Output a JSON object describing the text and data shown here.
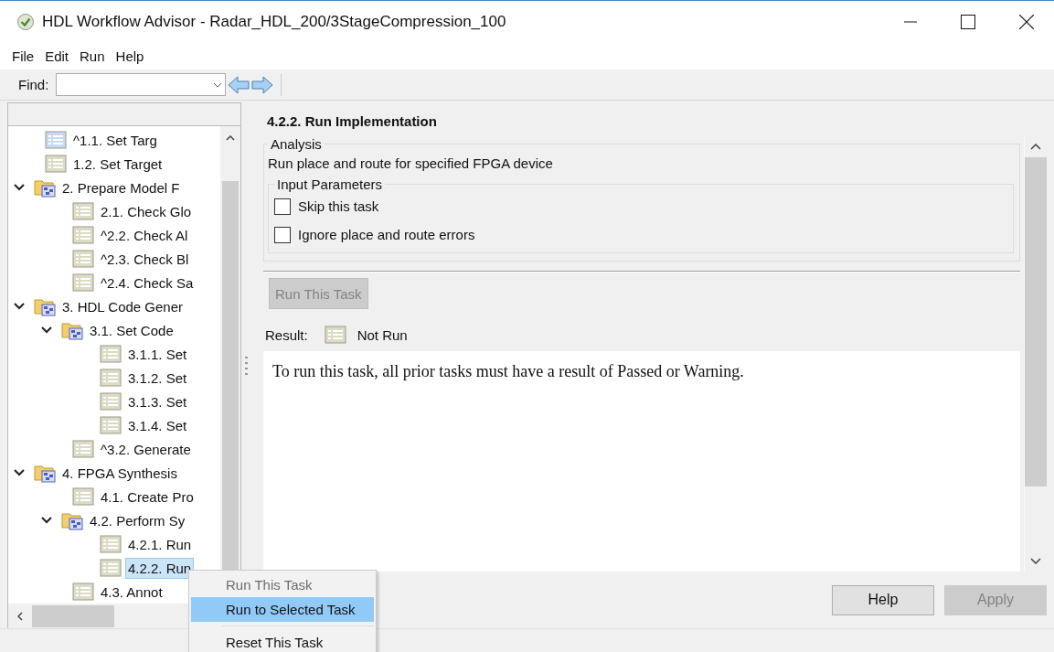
{
  "window": {
    "title": "HDL Workflow Advisor - Radar_HDL_200/3StageCompression_100"
  },
  "menu": [
    "File",
    "Edit",
    "Run",
    "Help"
  ],
  "toolbar": {
    "find_label": "Find:"
  },
  "tree": [
    {
      "kind": "task",
      "label": "^1.1. Set Targ",
      "color": "#c9d9f2",
      "selected": false
    },
    {
      "kind": "task",
      "label": "1.2. Set Target",
      "color": "#dcdcc6",
      "selected": false
    },
    {
      "kind": "folder",
      "label": "2. Prepare Model F",
      "expanded": true,
      "selected": false,
      "children": [
        {
          "kind": "task",
          "label": "2.1. Check Glo",
          "color": "#dcdcc6",
          "selected": false
        },
        {
          "kind": "task",
          "label": "^2.2. Check Al",
          "color": "#dcdcc6",
          "selected": false
        },
        {
          "kind": "task",
          "label": "^2.3. Check Bl",
          "color": "#dcdcc6",
          "selected": false
        },
        {
          "kind": "task",
          "label": "^2.4. Check Sa",
          "color": "#dcdcc6",
          "selected": false
        }
      ]
    },
    {
      "kind": "folder",
      "label": "3. HDL Code Gener",
      "expanded": true,
      "selected": false,
      "children": [
        {
          "kind": "folder",
          "label": "3.1. Set Code",
          "expanded": true,
          "selected": false,
          "children": [
            {
              "kind": "task",
              "label": "3.1.1. Set",
              "color": "#dcdcc6",
              "selected": false
            },
            {
              "kind": "task",
              "label": "3.1.2. Set",
              "color": "#dcdcc6",
              "selected": false
            },
            {
              "kind": "task",
              "label": "3.1.3. Set",
              "color": "#dcdcc6",
              "selected": false
            },
            {
              "kind": "task",
              "label": "3.1.4. Set",
              "color": "#dcdcc6",
              "selected": false
            }
          ]
        },
        {
          "kind": "task",
          "label": "^3.2. Generate",
          "color": "#dcdcc6",
          "selected": false
        }
      ]
    },
    {
      "kind": "folder",
      "label": "4. FPGA Synthesis",
      "expanded": true,
      "selected": false,
      "children": [
        {
          "kind": "task",
          "label": "4.1. Create Pro",
          "color": "#dcdcc6",
          "selected": false
        },
        {
          "kind": "folder",
          "label": "4.2. Perform Sy",
          "expanded": true,
          "selected": false,
          "children": [
            {
              "kind": "task",
              "label": "4.2.1. Run",
              "color": "#dcdcc6",
              "selected": false
            },
            {
              "kind": "task",
              "label": "4.2.2. Run",
              "color": "#dcdcc6",
              "selected": true
            }
          ]
        },
        {
          "kind": "task",
          "label": "4.3. Annot",
          "color": "#dcdcc6",
          "selected": false
        }
      ]
    }
  ],
  "task": {
    "heading": "4.2.2. Run Implementation",
    "analysis_title": "Analysis",
    "description": "Run place and route for specified FPGA device",
    "parameters_title": "Input Parameters",
    "options": [
      {
        "label": "Skip this task",
        "checked": false
      },
      {
        "label": "Ignore place and route errors",
        "checked": false
      }
    ],
    "run_button": {
      "label": "Run This Task",
      "disabled": true
    },
    "result_label": "Result:",
    "result_value": "Not Run",
    "message": "To run this task, all prior tasks must have a result of Passed or Warning."
  },
  "buttons": [
    {
      "label": "Help",
      "disabled": false
    },
    {
      "label": "Apply",
      "disabled": true
    }
  ],
  "context_menu": [
    {
      "label": "Run This Task",
      "disabled": true,
      "selected": false
    },
    {
      "label": "Run to Selected Task",
      "disabled": false,
      "selected": true
    },
    {
      "label": "Reset This Task",
      "disabled": false,
      "selected": false
    }
  ]
}
